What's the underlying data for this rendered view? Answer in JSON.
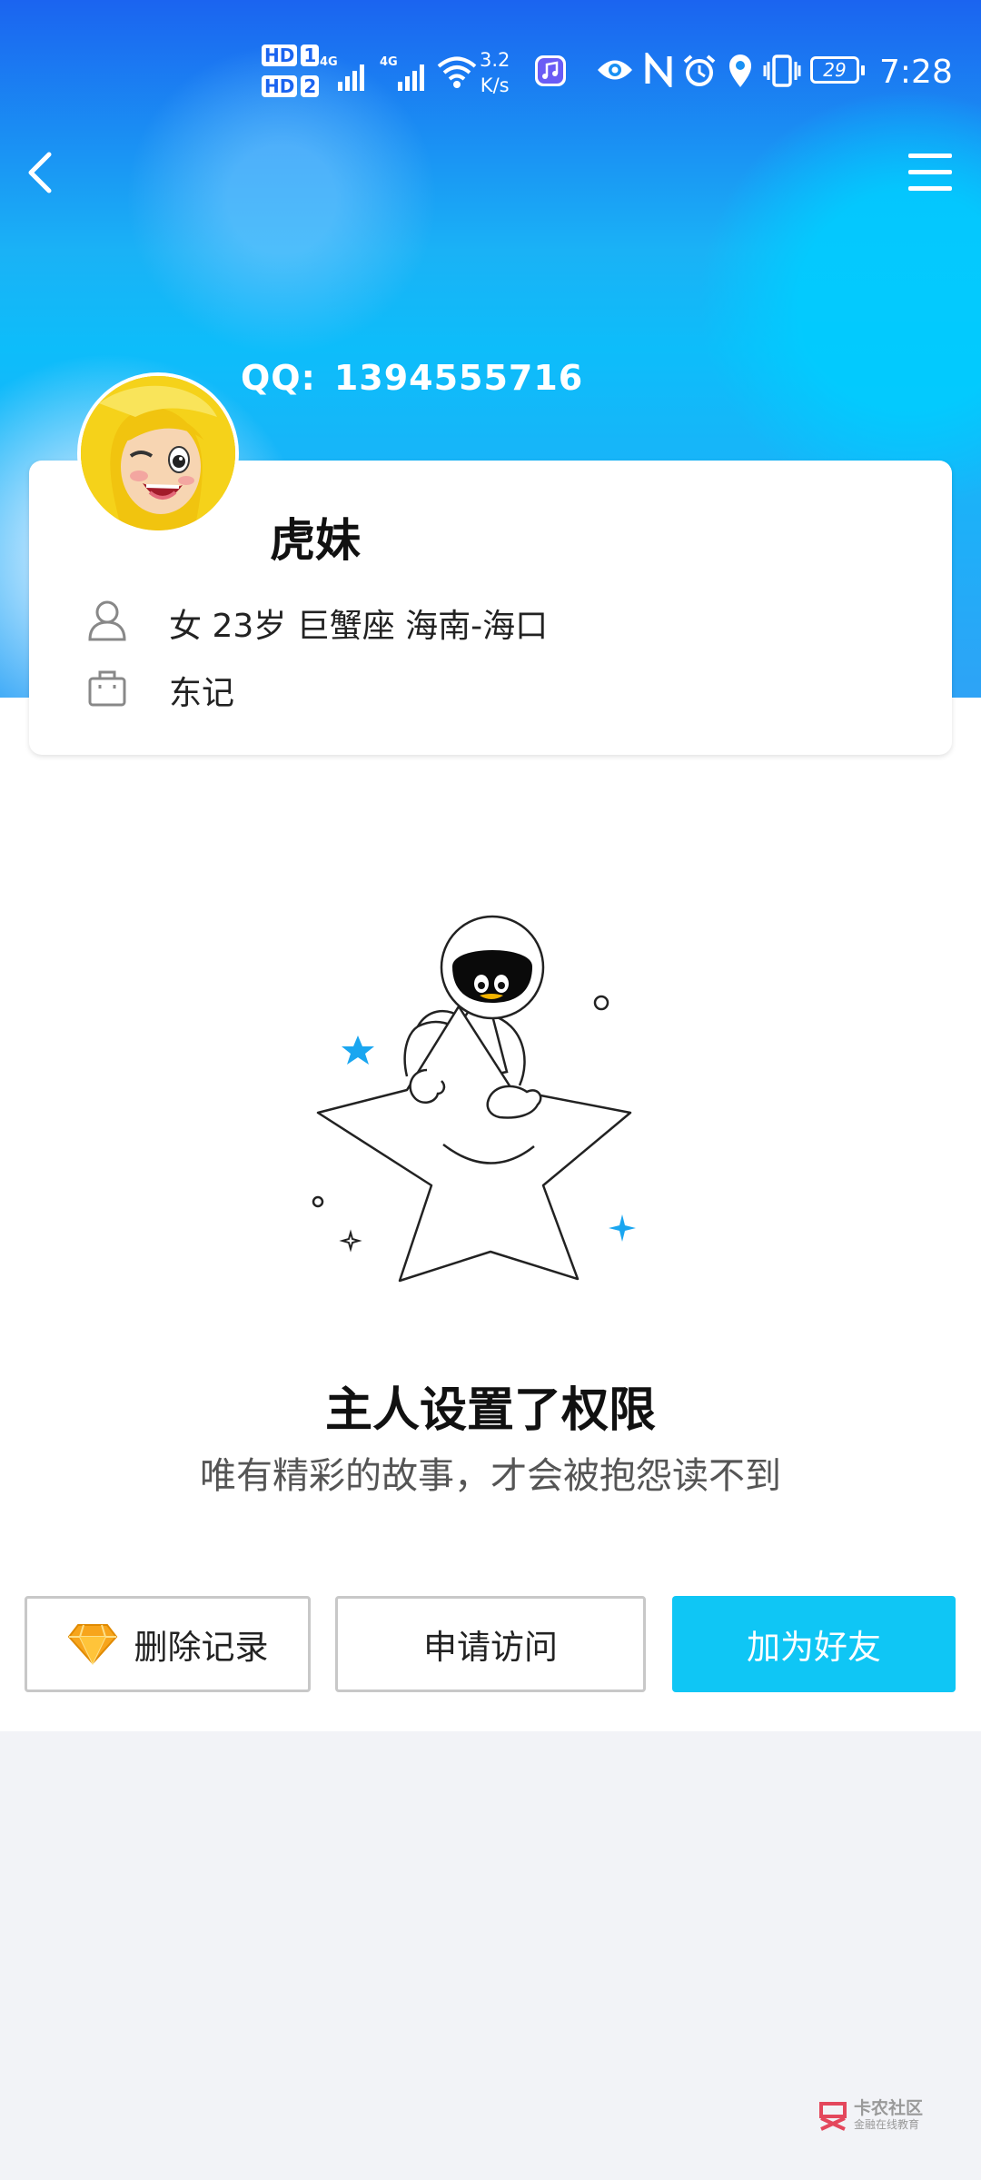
{
  "status_bar": {
    "sim1": "1",
    "sim2": "2",
    "network1": "4G",
    "network2": "4G",
    "speed_value": "3.2",
    "speed_unit": "K/s",
    "battery": "29",
    "time": "7:28",
    "icons": [
      "hd-icon",
      "signal-icon",
      "wifi-icon",
      "music-app-icon",
      "eye-icon",
      "nfc-icon",
      "alarm-icon",
      "location-icon",
      "vibrate-icon",
      "battery-icon"
    ]
  },
  "header": {
    "back_icon": "chevron-left-icon",
    "menu_icon": "hamburger-menu-icon"
  },
  "profile": {
    "qq_label": "QQ:",
    "qq_number": "1394555716",
    "name": "虎妹",
    "info": "女 23岁 巨蟹座 海南-海口",
    "company": "东记",
    "person_icon": "person-icon",
    "bag_icon": "briefcase-icon"
  },
  "empty_state": {
    "illustration": "astronaut-penguin-on-star",
    "title": "主人设置了权限",
    "subtitle": "唯有精彩的故事，才会被抱怨读不到"
  },
  "actions": {
    "delete_record": "删除记录",
    "request_access": "申请访问",
    "add_friend": "加为好友"
  },
  "watermark": {
    "name": "卡农社区",
    "sub": "金融在线教育"
  },
  "colors": {
    "primary": "#0fc6f5",
    "hero_top": "#1b64f0",
    "hero_mid": "#0dbdfa",
    "star_accent": "#1aa6f0"
  }
}
